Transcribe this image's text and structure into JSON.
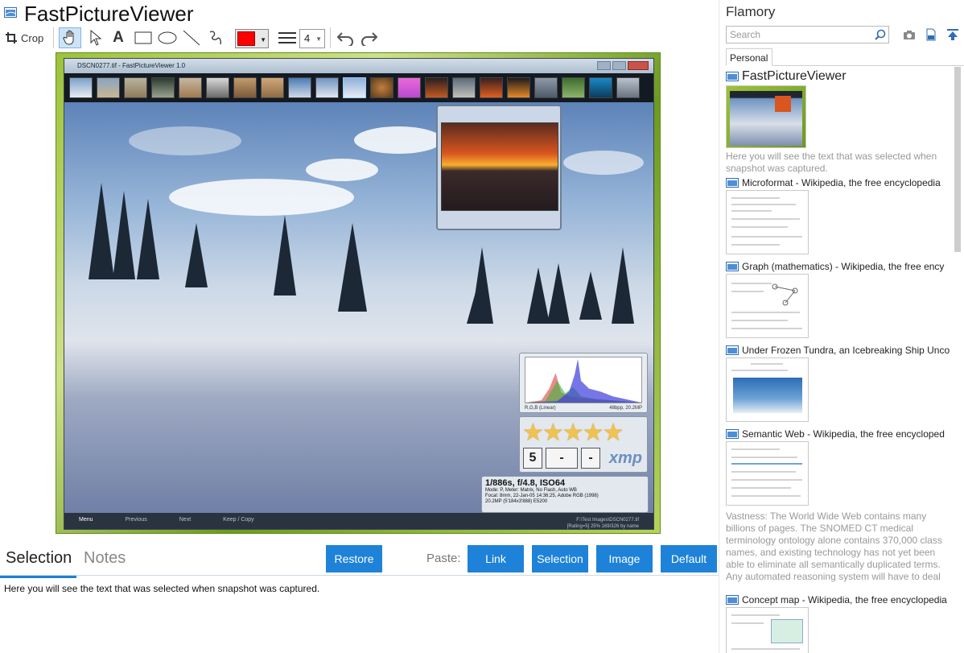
{
  "window": {
    "title": "FastPictureViewer"
  },
  "toolbar": {
    "crop_label": "Crop",
    "line_width": "4"
  },
  "snapshot": {
    "fpv_title": "DSCN0277.tif - FastPictureViewer 1.0",
    "exif_main": "1/886s, f/4.8, ISO64",
    "exif_line1": "Mode: P, Meter: Matrix, No Flash, Auto WB",
    "exif_line2": "Focal: 8mm, 22-Jan-05 14:36:25, Adobe RGB (1998)",
    "exif_line3": "20.2MP (5'184x3'888) E5200",
    "hist_left": "R,G,B (Linear)",
    "hist_right": "48bpp, 20.2MP",
    "rating_value": "5",
    "rating_dash1": "-",
    "rating_dash2": "-",
    "xmp_label": "xmp",
    "status_menu": "Menu",
    "status_prev": "Previous",
    "status_next": "Next",
    "status_keep": "Keep / Copy",
    "status_path": "F:\\Test Images\\DSCN0277.tif",
    "status_rating": "[Rating=5] 25%  169/326  by name"
  },
  "tabs": {
    "selection": "Selection",
    "notes": "Notes"
  },
  "actions": {
    "restore": "Restore",
    "paste_label": "Paste:",
    "link": "Link",
    "selection": "Selection",
    "image": "Image",
    "default": "Default"
  },
  "selection_text": "Here you will see the text that was selected when snapshot was captured.",
  "sidebar": {
    "brand": "Flamory",
    "search_placeholder": "Search",
    "tab_personal": "Personal",
    "items": [
      {
        "title": "FastPictureViewer",
        "desc": "Here you will see the text that was selected when snapshot was captured."
      },
      {
        "title": "Microformat - Wikipedia, the free encyclopedia",
        "desc": ""
      },
      {
        "title": "Graph (mathematics) - Wikipedia, the free ency",
        "desc": ""
      },
      {
        "title": "Under Frozen Tundra, an Icebreaking Ship Unco",
        "desc": ""
      },
      {
        "title": "Semantic Web - Wikipedia, the free encycloped",
        "desc": "Vastness: The World Wide Web contains many billions of pages. The SNOMED CT medical terminology ontology alone contains 370,000 class names, and existing technology has not yet been able to eliminate all semantically duplicated terms. Any automated reasoning system will have to deal with truly huge inputs."
      },
      {
        "title": "Concept map - Wikipedia, the free encyclopedia",
        "desc": ""
      }
    ]
  },
  "colors": {
    "accent": "#1e82d8",
    "stroke_color": "#ff0000"
  }
}
